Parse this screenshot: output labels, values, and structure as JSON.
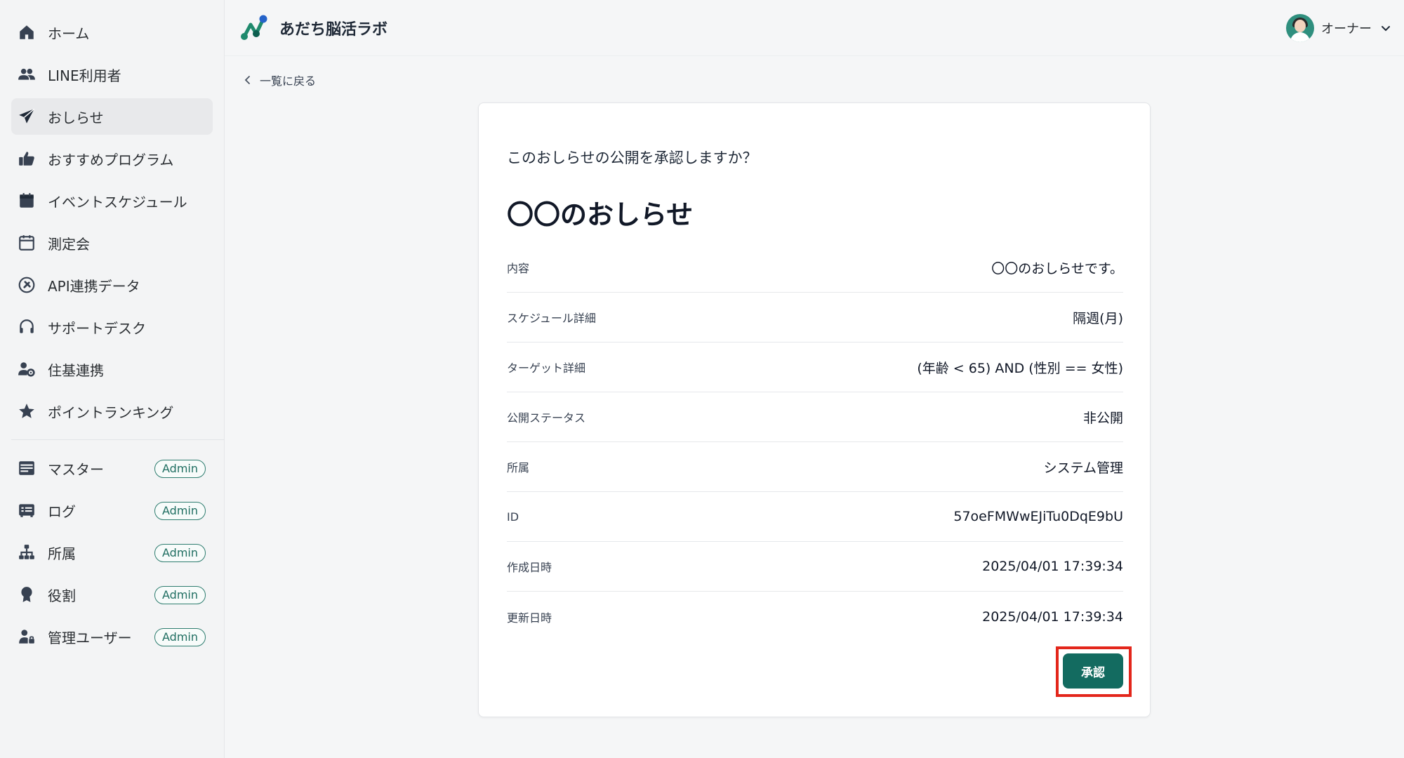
{
  "header": {
    "brand_name": "あだち脳活ラボ",
    "user_name": "オーナー"
  },
  "sidebar": {
    "items": [
      {
        "label": "ホーム",
        "icon": "home-icon"
      },
      {
        "label": "LINE利用者",
        "icon": "users-icon"
      },
      {
        "label": "おしらせ",
        "icon": "paper-plane-icon",
        "active": true
      },
      {
        "label": "おすすめプログラム",
        "icon": "thumbs-up-icon"
      },
      {
        "label": "イベントスケジュール",
        "icon": "calendar-filled-icon"
      },
      {
        "label": "測定会",
        "icon": "calendar-outline-icon"
      },
      {
        "label": "API連携データ",
        "icon": "plug-circle-icon"
      },
      {
        "label": "サポートデスク",
        "icon": "headset-icon"
      },
      {
        "label": "住基連携",
        "icon": "user-gear-icon"
      },
      {
        "label": "ポイントランキング",
        "icon": "star-icon"
      }
    ],
    "admin_items": [
      {
        "label": "マスター",
        "icon": "database-icon",
        "badge": "Admin"
      },
      {
        "label": "ログ",
        "icon": "log-icon",
        "badge": "Admin"
      },
      {
        "label": "所属",
        "icon": "org-chart-icon",
        "badge": "Admin"
      },
      {
        "label": "役割",
        "icon": "award-icon",
        "badge": "Admin"
      },
      {
        "label": "管理ユーザー",
        "icon": "user-lock-icon",
        "badge": "Admin"
      }
    ]
  },
  "back_link": "一覧に戻る",
  "card": {
    "prompt": "このおしらせの公開を承認しますか？",
    "title": "〇〇のおしらせ",
    "rows": [
      {
        "label": "内容",
        "value": "〇〇のおしらせです。"
      },
      {
        "label": "スケジュール詳細",
        "value": "隔週(月)"
      },
      {
        "label": "ターゲット詳細",
        "value": "(年齢 < 65) AND (性別 == 女性)"
      },
      {
        "label": "公開ステータス",
        "value": "非公開"
      },
      {
        "label": "所属",
        "value": "システム管理"
      },
      {
        "label": "ID",
        "value": "57oeFMWwEJiTu0DqE9bU"
      },
      {
        "label": "作成日時",
        "value": "2025/04/01 17:39:34"
      },
      {
        "label": "更新日時",
        "value": "2025/04/01 17:39:34"
      }
    ],
    "approve_label": "承認"
  },
  "colors": {
    "accent": "#136b60",
    "highlight": "#e3261b",
    "badge": "#2e7d6f"
  }
}
